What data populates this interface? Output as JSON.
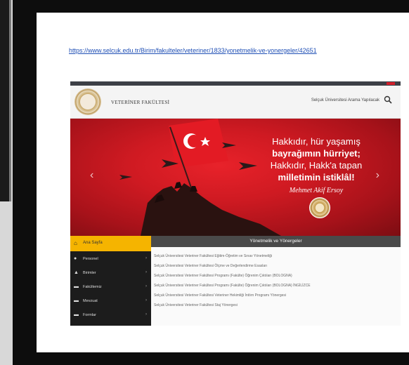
{
  "url_text": "https://www.selcuk.edu.tr/Birim/fakulteler/veteriner/1833/yonetmelik-ve-yonergeler/42651",
  "site": {
    "faculty_title": "VETERİNER FAKÜLTESİ",
    "search_label": "Selçuk Üniversitesi Arama Yapılacak"
  },
  "banner": {
    "line1": "Hakkıdır, hür yaşamış",
    "line2": "bayrağımın hürriyet;",
    "line3": "Hakkıdır, Hakk'a tapan",
    "line4": "milletimin istiklâl!",
    "signature": "Mehmet Akif Ersoy"
  },
  "sidebar": {
    "active": "Ana Sayfa",
    "items": [
      "Personel",
      "Birimler",
      "Fakültemiz",
      "Mevzuat",
      "Formlar"
    ]
  },
  "content": {
    "heading": "Yönetmelik ve Yönergeler",
    "items": [
      "Selçuk Üniversitesi Veteriner Fakültesi Eğitim-Öğretim ve Sınav Yönetmeliği",
      "Selçuk Üniversitesi Veteriner Fakültesi Ölçme ve Değerlendirme Esasları",
      "Selçuk Üniversitesi Veteriner Fakültesi Programı (Fakülte) Öğrenim Çıktıları (BOLOGNA)",
      "Selçuk Üniversitesi Veteriner Fakültesi Programı (Fakülte) Öğrenim Çıktıları (BOLOGNA) İNGİLİZCE",
      "Selçuk Üniversitesi Veteriner Fakültesi Veteriner Hekimliği İntörn Programı Yönergesi",
      "Selçuk Üniversitesi Veteriner Fakültesi Staj Yönergesi"
    ]
  },
  "colors": {
    "banner_red": "#cf1a22",
    "sidebar_active": "#f5b400",
    "link_blue": "#1f4fb5"
  }
}
